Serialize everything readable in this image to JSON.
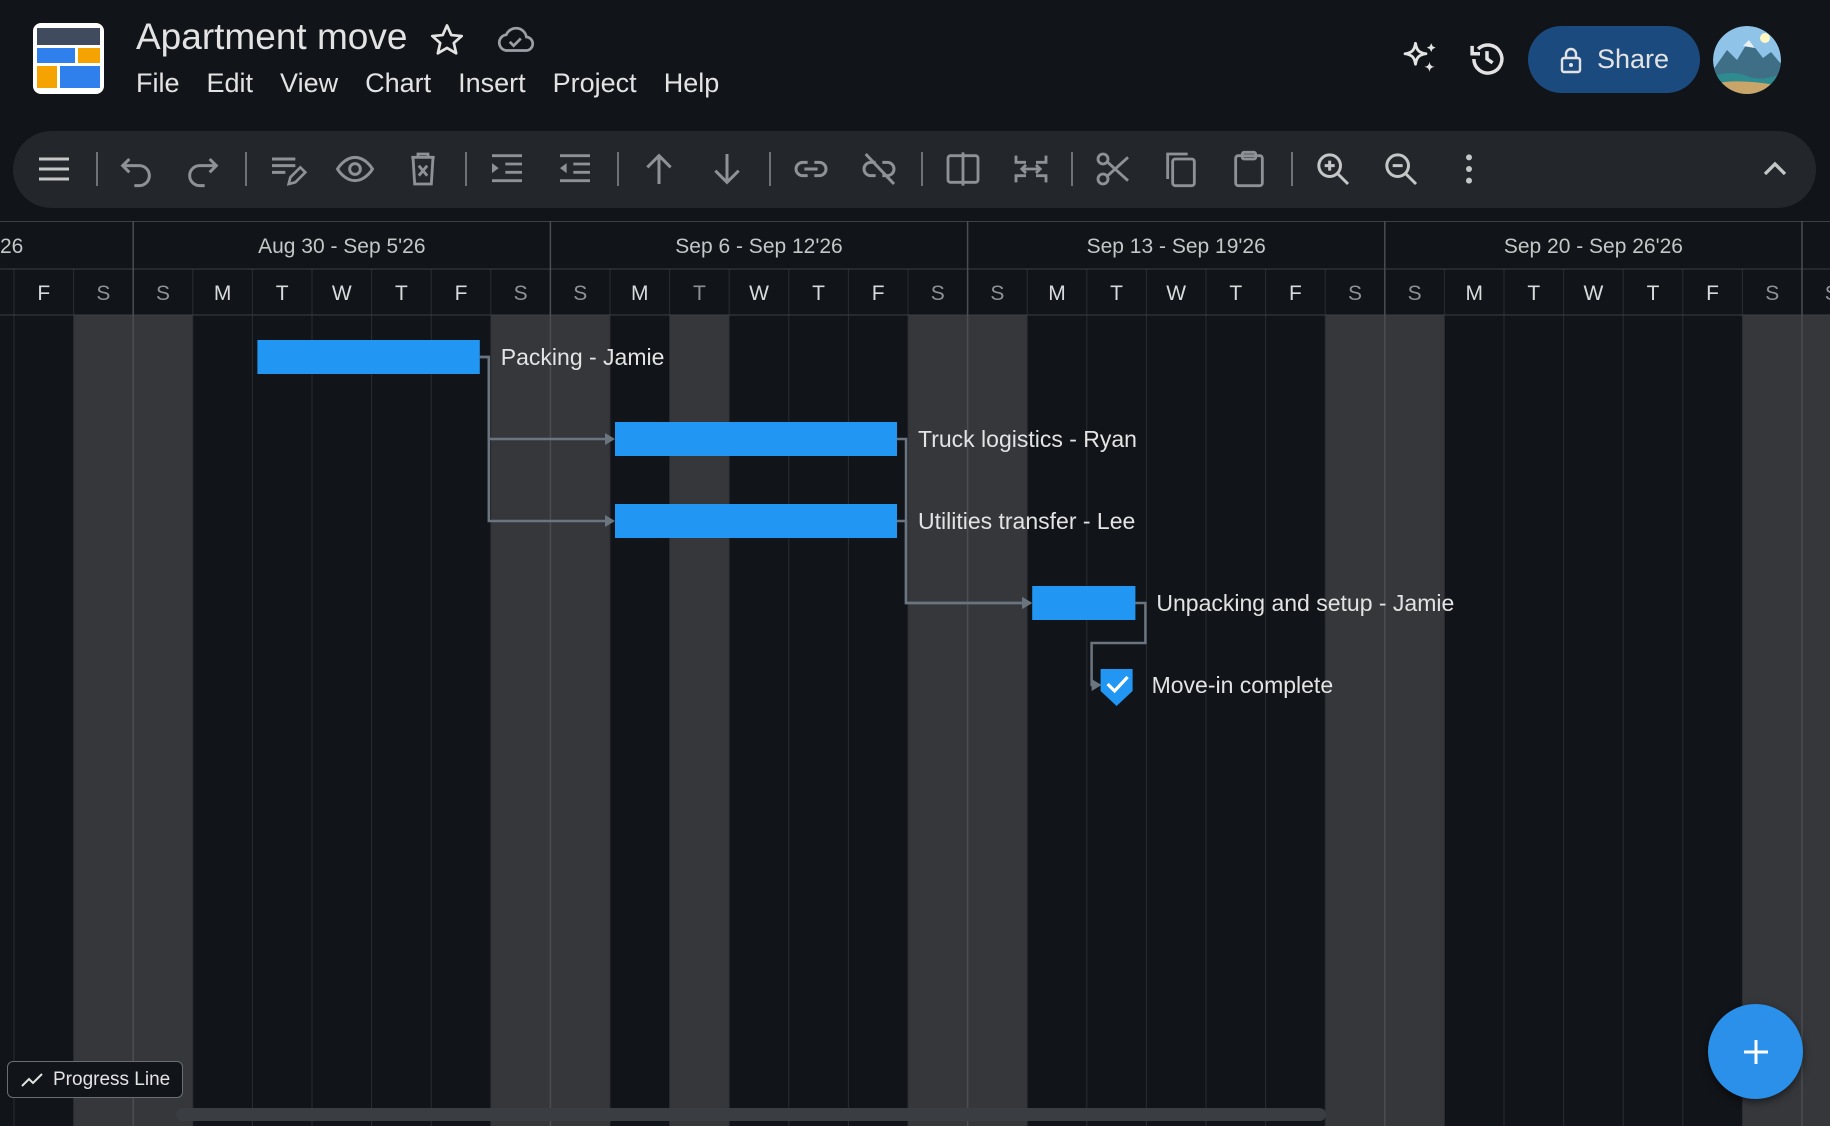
{
  "header": {
    "doc_title": "Apartment move",
    "menu": [
      "File",
      "Edit",
      "View",
      "Chart",
      "Insert",
      "Project",
      "Help"
    ],
    "share_label": "Share"
  },
  "toolbar": {
    "icons": [
      "menu-icon",
      "undo-icon",
      "redo-icon",
      "edit-task-icon",
      "view-icon",
      "delete-task-icon",
      "indent-icon",
      "outdent-icon",
      "move-up-icon",
      "move-down-icon",
      "link-icon",
      "unlink-icon",
      "split-icon",
      "merge-icon",
      "cut-icon",
      "copy-icon",
      "paste-icon",
      "zoom-in-icon",
      "zoom-out-icon",
      "more-icon",
      "collapse-icon"
    ]
  },
  "timeline": {
    "first_visible_date": "2026-08-28",
    "partial_week_label": "26",
    "weeks": [
      "Aug 30 - Sep 5'26",
      "Sep 6 - Sep 12'26",
      "Sep 13 - Sep 19'26",
      "Sep 20 - Sep 26'26"
    ],
    "day_letters": [
      "F",
      "S",
      "S",
      "M",
      "T",
      "W",
      "T",
      "F",
      "S",
      "S",
      "M",
      "T",
      "W",
      "T",
      "F",
      "S",
      "S",
      "M",
      "T",
      "W",
      "T",
      "F",
      "S",
      "S",
      "M",
      "T",
      "W",
      "T",
      "F",
      "S",
      "S"
    ],
    "highlighted_day": "2026-09-08"
  },
  "tasks": [
    {
      "id": "packing",
      "label": "Packing - Jamie",
      "start": "2026-09-01",
      "end": "2026-09-04",
      "type": "task"
    },
    {
      "id": "truck",
      "label": "Truck logistics - Ryan",
      "start": "2026-09-07",
      "end": "2026-09-11",
      "type": "task"
    },
    {
      "id": "utilities",
      "label": "Utilities transfer - Lee",
      "start": "2026-09-07",
      "end": "2026-09-11",
      "type": "task"
    },
    {
      "id": "unpacking",
      "label": "Unpacking and setup - Jamie",
      "start": "2026-09-14",
      "end": "2026-09-15",
      "type": "task"
    },
    {
      "id": "movein",
      "label": "Move-in complete",
      "date": "2026-09-15",
      "type": "milestone"
    }
  ],
  "dependencies": [
    {
      "from": "packing",
      "to": "truck"
    },
    {
      "from": "packing",
      "to": "utilities"
    },
    {
      "from": "truck",
      "to": "unpacking"
    },
    {
      "from": "utilities",
      "to": "unpacking"
    },
    {
      "from": "unpacking",
      "to": "movein"
    }
  ],
  "bottom": {
    "progress_line_label": "Progress Line"
  },
  "colors": {
    "background": "#111418",
    "weekend": "#35373b",
    "bar": "#2196f3",
    "link": "#6b7580",
    "accent": "#1b4a7e"
  }
}
